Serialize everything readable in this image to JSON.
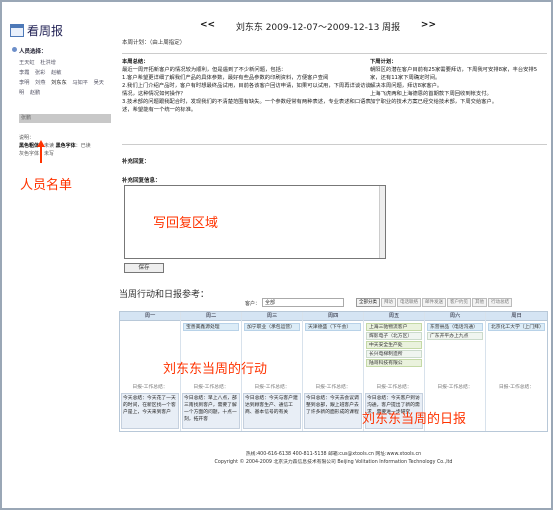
{
  "app": {
    "title": "看周报"
  },
  "sidebar": {
    "people_title": "人员选择：",
    "names": [
      "王天虹",
      "杜洪增",
      "李霞",
      "张彩",
      "赵敏",
      "李明",
      "刘燕",
      "刘东东",
      "马如平",
      "吴天明",
      "赵鹏"
    ],
    "selected_name": "刘东东",
    "selected_bar": "张鹏",
    "legend_title": "说明：",
    "legend_black_label": "黑色粗体",
    "legend_black_value": "：未读",
    "legend_gray_label": "黑色字体",
    "legend_gray_value": "：已读",
    "legend_line2": "灰色字体：未写"
  },
  "annotations": {
    "people_list": "人员名单",
    "reply_area": "写回复区域",
    "actions": "刘东东当周的行动",
    "daily_reports": "刘东东当周的日报"
  },
  "week_nav": {
    "prev": "<<",
    "title": "刘东东 2009-12-07～2009-12-13 周报",
    "next": ">>"
  },
  "plan_title": "本周计划：（由上周指定）",
  "report": {
    "summary_label": "本周总结：",
    "summary": "最近一周开拓新客户的情况较为顺利，但是遇到了不少新问题，包括：",
    "item1": "1.客户希望更详细了解我们产品的具体参数，最好有些品参数的印刷资料，方便客户查阅",
    "item2": "2.我们上门介绍产品时，客户有时想最终品试用，目前各该客户回访申请，如果可以试用，下周再详谈访谈情况，这种情况如何操作？",
    "item3": "3.技术部的问题跟我配合时，发现我们的不清楚范围有缺失。一个参数经常有两种表述，专业表述和口语表述，希望能有一个统一的标准。",
    "next_label": "下周计划：",
    "next_plan": "朝阳区的潜在客户目前有25家需要拜访，下周我可安排8家，丰台安排5家，还有11家下周确定时间。",
    "next_plan2": "解决本周问题，拜访8家客户。",
    "next_plan3": "上海飞虎两和上海德恩的首期款下周回收到帐支付。",
    "next_plan4": "加宁职业的技术方案已经交给技术部，下周交给客户。"
  },
  "reply": {
    "title": "补充回复：",
    "info_label": "补充回复信息：",
    "save": "保存"
  },
  "actions_section": {
    "title": "当周行动和日报参考：",
    "customer_label": "客户：",
    "customer_value": "全部",
    "toolbar": [
      "全部分类",
      "拜访",
      "电话联络",
      "邮件发送",
      "客户约见",
      "其他",
      "行动总结"
    ]
  },
  "calendar": {
    "days": [
      {
        "name": "周一",
        "events": [],
        "log_label": "日报-工作总结：",
        "log": "今天总结：今天花了一天的时间，在新区找一个客户是上，今天来到客户"
      },
      {
        "name": "周二",
        "events": [
          {
            "text": "宝善美鑫源处理",
            "kind": "a"
          }
        ],
        "log_label": "日报-工作总结：",
        "log": "今日总结：早上八点，部三南找到客户，需要了解一个方面的问题，十点一刻，拓开客"
      },
      {
        "name": "周三",
        "events": [
          {
            "text": "加宁职业（承包运营）",
            "kind": "a"
          }
        ],
        "log_label": "日报-工作总结：",
        "log": "今日总结：今天与客户建达到顾客生产、通信工商、基本信号的有关"
      },
      {
        "name": "周四",
        "events": [
          {
            "text": "天津德盛（下午会）",
            "kind": "a"
          }
        ],
        "log_label": "日报-工作总结：",
        "log": "今日总结：今天去会议调整到总部，跟上班客户去了许多新的面形成的课程"
      },
      {
        "name": "周五",
        "events": [
          {
            "text": "上海三驰物流客户",
            "kind": "b"
          },
          {
            "text": "辉影电子（北方区）",
            "kind": "c"
          },
          {
            "text": "中天安全生产处",
            "kind": "b"
          },
          {
            "text": "长兴电梯制造所",
            "kind": "c"
          },
          {
            "text": "陆哥科技有限公",
            "kind": "b"
          }
        ],
        "log_label": "日报-工作总结：",
        "log": "今日总结：今天客户到访沟通，客户提出了新的需求，需要进一步研究"
      },
      {
        "name": "周六",
        "events": [
          {
            "text": "东营县品（电话沟通）",
            "kind": "a"
          },
          {
            "text": "广东开平办上九点",
            "kind": "c"
          }
        ],
        "log_label": "日报-工作总结：",
        "log": ""
      },
      {
        "name": "周日",
        "events": [
          {
            "text": "北京化工大学（上门拜）",
            "kind": "a"
          }
        ],
        "log_label": "日报-工作总结：",
        "log": ""
      }
    ]
  },
  "footer": {
    "line1": "热线:400-616-6138  400-811-5138  邮箱:cus@xtools.cn  网址:www.xtools.cn",
    "line2": "Copyright © 2004-2009 北京沃力森信息技术有限公司  Beijing Volitation Information Technology Co.,ltd"
  }
}
